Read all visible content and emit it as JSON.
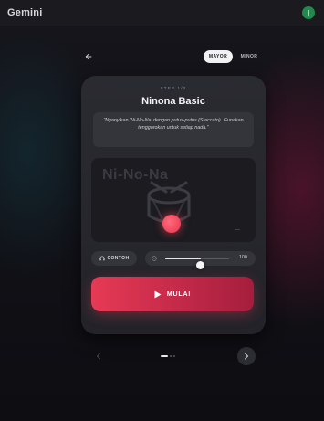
{
  "app": {
    "title": "Gemini",
    "avatar_initial": "I"
  },
  "mode_toggle": {
    "active": "MAYOR",
    "inactive": "MINOR"
  },
  "lesson": {
    "step_label": "STEP 1/3",
    "title": "Ninona Basic",
    "instruction": "\"Nyanyikan 'Ni-No-Na' dengan putus-putus (Staccato). Gunakan tenggorokan untuk setiap nada.\"",
    "syllable": "Ni-No-Na"
  },
  "controls": {
    "example_label": "CONTOH",
    "tempo_value": "100",
    "tempo_level": 0.55
  },
  "start_button": {
    "label": "MULAI"
  },
  "pagination": {
    "current": 1,
    "total": 3
  },
  "icons": {
    "back": "arrow-left-icon",
    "headphones": "headphones-icon",
    "tempo": "metronome-icon",
    "play": "play-icon",
    "prev": "chevron-left-icon",
    "next": "chevron-right-icon",
    "drum": "drum-icon"
  },
  "colors": {
    "accent": "#e63a55",
    "card": "#2a2a31",
    "avatar": "#1f8a4c"
  }
}
